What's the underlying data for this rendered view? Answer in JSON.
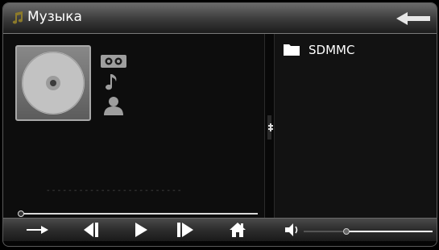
{
  "window": {
    "title": "Музыка"
  },
  "sources": {
    "items": [
      {
        "label": "SDMMC",
        "icon": "folder-icon"
      }
    ]
  },
  "now_playing": {
    "track_info_placeholder": "- - - - - - - - - - - - - - - - - - - - - - - - -",
    "progress_fraction": 0,
    "meta_icons": [
      "album-icon",
      "note-icon",
      "artist-icon"
    ]
  },
  "controls": {
    "buttons": [
      "repeat-icon",
      "previous-icon",
      "play-icon",
      "next-icon",
      "home-icon",
      "volume-icon"
    ],
    "volume_fraction": 0.33
  },
  "colors": {
    "background": "#000000",
    "titlebar": "#4a4a4a",
    "panel_left": "#0d0d0d",
    "panel_right": "#121212",
    "text": "#ffffff"
  }
}
